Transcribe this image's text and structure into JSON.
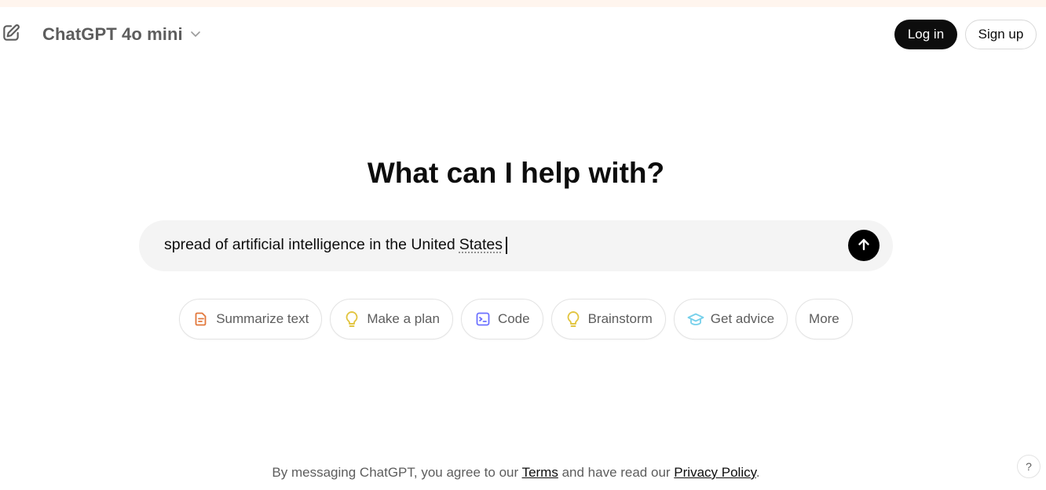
{
  "header": {
    "model_name": "ChatGPT 4o mini",
    "new_chat_icon": "edit-pencil-icon",
    "model_chevron_icon": "chevron-down-icon",
    "login_label": "Log in",
    "signup_label": "Sign up"
  },
  "main": {
    "headline": "What can I help with?",
    "composer": {
      "value_prefix": "spread of artificial intelligence in the United",
      "value_misspelled_word": "States",
      "send_icon": "arrow-up-icon"
    },
    "chips": [
      {
        "label": "Summarize text",
        "icon": "document-icon",
        "color": "#e2773b"
      },
      {
        "label": "Make a plan",
        "icon": "lightbulb-icon",
        "color": "#e2c541"
      },
      {
        "label": "Code",
        "icon": "terminal-icon",
        "color": "#6c71ff"
      },
      {
        "label": "Brainstorm",
        "icon": "lightbulb-icon",
        "color": "#e2c541"
      },
      {
        "label": "Get advice",
        "icon": "graduation-cap-icon",
        "color": "#76d0eb"
      },
      {
        "label": "More",
        "icon": "",
        "color": ""
      }
    ]
  },
  "footer": {
    "prefix": "By messaging ChatGPT, you agree to our ",
    "terms_link": "Terms",
    "middle": " and have read our ",
    "privacy_link": "Privacy Policy",
    "suffix": "."
  },
  "help": {
    "label": "?"
  },
  "colors": {
    "top_strip": "#fff5ee",
    "composer_bg": "#f4f4f4",
    "primary_button": "#0d0d0d"
  }
}
